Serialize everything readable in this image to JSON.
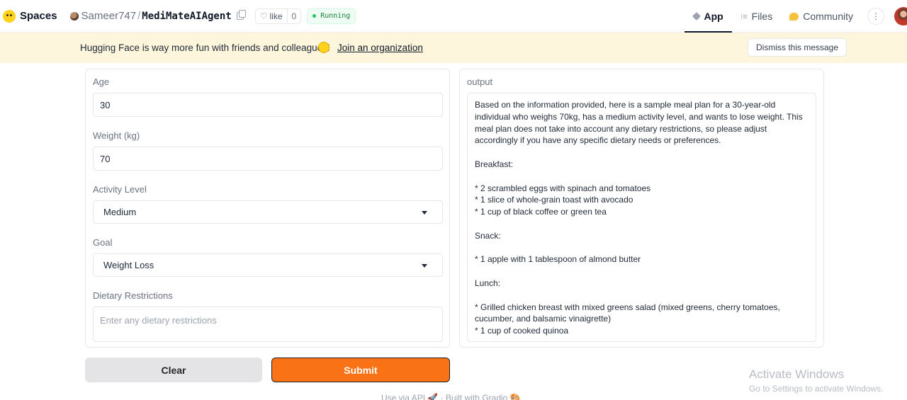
{
  "header": {
    "spaces_label": "Spaces",
    "owner": "Sameer747",
    "separator": "/",
    "repo_name": "MediMateAIAgent",
    "like_label": "like",
    "like_count": "0",
    "status": "Running",
    "tabs": [
      {
        "label": "App",
        "active": true
      },
      {
        "label": "Files",
        "active": false
      },
      {
        "label": "Community",
        "active": false
      }
    ]
  },
  "banner": {
    "message": "Hugging Face is way more fun with friends and colleagues!",
    "link": "Join an organization",
    "dismiss": "Dismiss this message"
  },
  "form": {
    "age": {
      "label": "Age",
      "value": "30"
    },
    "weight": {
      "label": "Weight (kg)",
      "value": "70"
    },
    "activity": {
      "label": "Activity Level",
      "value": "Medium"
    },
    "goal": {
      "label": "Goal",
      "value": "Weight Loss"
    },
    "dietary": {
      "label": "Dietary Restrictions",
      "placeholder": "Enter any dietary restrictions"
    }
  },
  "output": {
    "label": "output",
    "text": "Based on the information provided, here is a sample meal plan for a 30-year-old individual who weighs 70kg, has a medium activity level, and wants to lose weight. This meal plan does not take into account any dietary restrictions, so please adjust accordingly if you have any specific dietary needs or preferences.\n\nBreakfast:\n\n* 2 scrambled eggs with spinach and tomatoes\n* 1 slice of whole-grain toast with avocado\n* 1 cup of black coffee or green tea\n\nSnack:\n\n* 1 apple with 1 tablespoon of almond butter\n\nLunch:\n\n* Grilled chicken breast with mixed greens salad (mixed greens, cherry tomatoes, cucumber, and balsamic vinaigrette)\n* 1 cup of cooked quinoa"
  },
  "buttons": {
    "clear": "Clear",
    "submit": "Submit"
  },
  "footer": {
    "text": "Use via API 🚀 · Built with Gradio 🎨"
  },
  "watermark": {
    "title": "Activate Windows",
    "subtitle": "Go to Settings to activate Windows."
  },
  "colors": {
    "accent": "#f97316",
    "banner_bg": "#fdf6dc",
    "status_green": "#22c55e"
  }
}
